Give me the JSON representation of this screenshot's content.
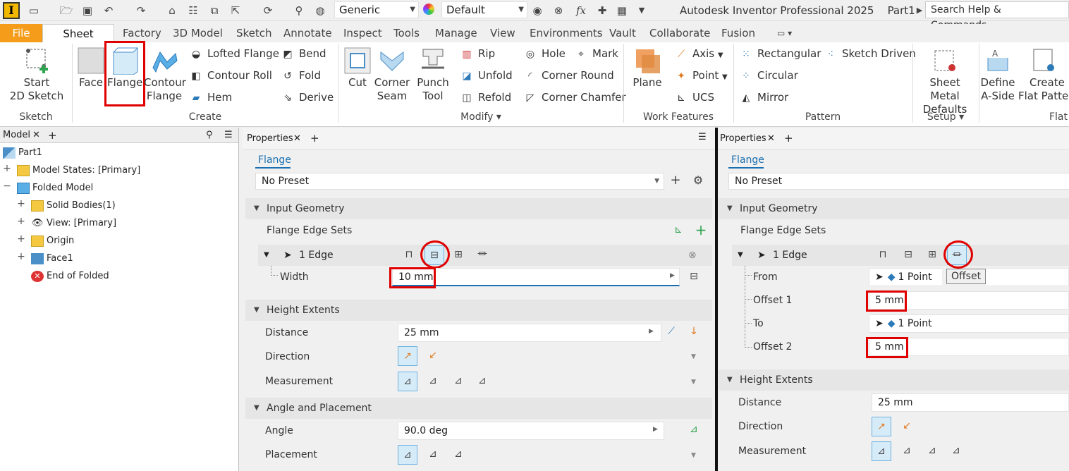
{
  "app": {
    "title": "Autodesk Inventor Professional 2025",
    "doc": "Part1",
    "search_placeholder": "Search Help & Commands...",
    "style_dropdown": "Generic",
    "appearance_dropdown": "Default"
  },
  "tabs": [
    "File",
    "Sheet Metal",
    "Factory",
    "3D Model",
    "Sketch",
    "Annotate",
    "Inspect",
    "Tools",
    "Manage",
    "View",
    "Environments",
    "Vault",
    "Collaborate",
    "Fusion"
  ],
  "ribbon": {
    "sketch": {
      "start_line1": "Start",
      "start_line2": "2D Sketch",
      "group": "Sketch"
    },
    "create": {
      "face": "Face",
      "flange": "Flange",
      "contour_line1": "Contour",
      "contour_line2": "Flange",
      "lofted": "Lofted Flange",
      "contour_roll": "Contour Roll",
      "hem": "Hem",
      "bend": "Bend",
      "fold": "Fold",
      "derive": "Derive",
      "group": "Create"
    },
    "modify": {
      "cut": "Cut",
      "corner_line1": "Corner",
      "corner_line2": "Seam",
      "punch_line1": "Punch",
      "punch_line2": "Tool",
      "rip": "Rip",
      "unfold": "Unfold",
      "refold": "Refold",
      "hole": "Hole",
      "corner_round": "Corner Round",
      "corner_chamfer": "Corner Chamfer",
      "mark": "Mark",
      "group": "Modify"
    },
    "work": {
      "plane": "Plane",
      "axis": "Axis",
      "point": "Point",
      "ucs": "UCS",
      "group": "Work Features"
    },
    "pattern": {
      "rectangular": "Rectangular",
      "circular": "Circular",
      "mirror": "Mirror",
      "sketch_driven": "Sketch Driven",
      "group": "Pattern"
    },
    "setup": {
      "sm_line1": "Sheet Metal",
      "sm_line2": "Defaults",
      "group": "Setup"
    },
    "flat": {
      "define_line1": "Define",
      "define_line2": "A-Side",
      "create_line1": "Create",
      "create_line2": "Flat Pattern",
      "group": "Flat"
    }
  },
  "model_panel": {
    "tab": "Model",
    "items": [
      "Part1",
      "Model States: [Primary]",
      "Folded Model",
      "Solid Bodies(1)",
      "View: [Primary]",
      "Origin",
      "Face1",
      "End of Folded"
    ]
  },
  "props_left": {
    "tab": "Properties",
    "title": "Flange",
    "preset": "No Preset",
    "input_geometry": "Input Geometry",
    "edge_sets": "Flange Edge Sets",
    "edge": "1 Edge",
    "width_label": "Width",
    "width_value": "10 mm",
    "height_extents": "Height Extents",
    "distance_label": "Distance",
    "distance_value": "25 mm",
    "direction_label": "Direction",
    "measurement_label": "Measurement",
    "angle_placement": "Angle and Placement",
    "angle_label": "Angle",
    "angle_value": "90.0 deg",
    "placement_label": "Placement"
  },
  "props_right": {
    "tab": "Properties",
    "title": "Flange",
    "preset": "No Preset",
    "input_geometry": "Input Geometry",
    "edge_sets": "Flange Edge Sets",
    "edge": "1 Edge",
    "from_label": "From",
    "from_value": "1 Point",
    "tooltip": "Offset",
    "offset1_label": "Offset 1",
    "offset1_value": "5 mm",
    "to_label": "To",
    "to_value": "1 Point",
    "offset2_label": "Offset 2",
    "offset2_value": "5 mm",
    "height_extents": "Height Extents",
    "distance_label": "Distance",
    "distance_value": "25 mm",
    "direction_label": "Direction",
    "measurement_label": "Measurement"
  },
  "colors": {
    "accent": "#1a6fb0",
    "file_tab": "#f59d1a",
    "highlight": "#e00000"
  }
}
